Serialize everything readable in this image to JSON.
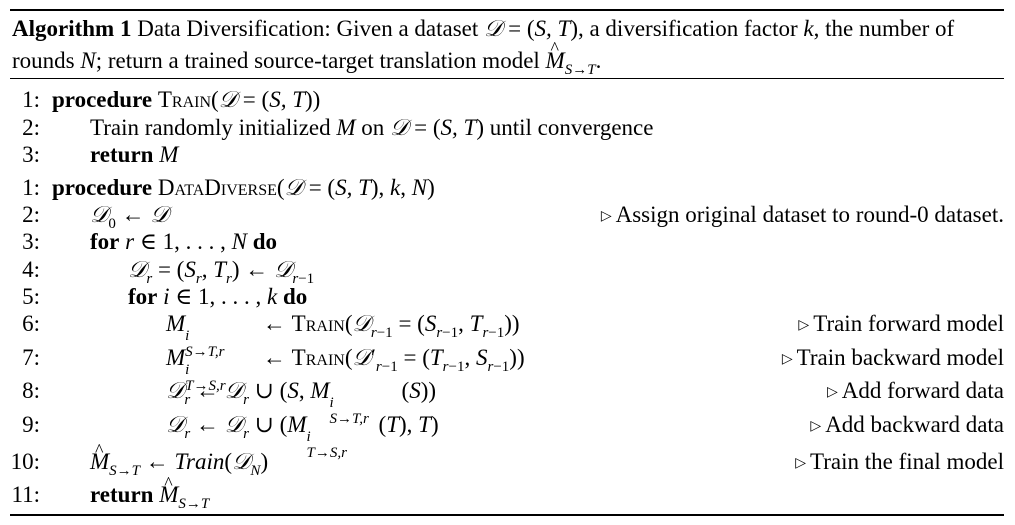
{
  "algorithm": {
    "label": "Algorithm 1",
    "caption": "Data Diversification: Given a dataset 𝒟 = (S, T), a diversification factor k, the number of rounds N; return a trained source-target translation model M̂S→T."
  },
  "train_procedure": {
    "lines": [
      {
        "num": "1:",
        "text": "procedure Train(𝒟 = (S, T))"
      },
      {
        "num": "2:",
        "text": "Train randomly initialized M on 𝒟 = (S, T) until convergence"
      },
      {
        "num": "3:",
        "text": "return M"
      }
    ]
  },
  "datadiverse_procedure": {
    "lines": [
      {
        "num": "1:",
        "text": "procedure DataDiverse(𝒟 = (S, T), k, N)",
        "comment": ""
      },
      {
        "num": "2:",
        "text": "𝒟0 ← 𝒟",
        "comment": "Assign original dataset to round-0 dataset."
      },
      {
        "num": "3:",
        "text": "for r ∈ 1, . . . , N do",
        "comment": ""
      },
      {
        "num": "4:",
        "text": "𝒟r = (Sr, Tr) ← 𝒟r−1",
        "comment": ""
      },
      {
        "num": "5:",
        "text": "for i ∈ 1, . . . , k do",
        "comment": ""
      },
      {
        "num": "6:",
        "text": "M i S→T,r ← Train(𝒟r−1 = (Sr−1, Tr−1))",
        "comment": "Train forward model"
      },
      {
        "num": "7:",
        "text": "M i T→S,r ← Train(𝒟′r−1 = (Tr−1, Sr−1))",
        "comment": "Train backward model"
      },
      {
        "num": "8:",
        "text": "𝒟r ← 𝒟r ∪ (S, M i S→T,r(S))",
        "comment": "Add forward data"
      },
      {
        "num": "9:",
        "text": "𝒟r ← 𝒟r ∪ (M i T→S,r(T), T)",
        "comment": "Add backward data"
      },
      {
        "num": "10:",
        "text": "M̂S→T ← Train(𝒟N)",
        "comment": "Train the final model"
      },
      {
        "num": "11:",
        "text": "return M̂S→T",
        "comment": ""
      }
    ]
  }
}
